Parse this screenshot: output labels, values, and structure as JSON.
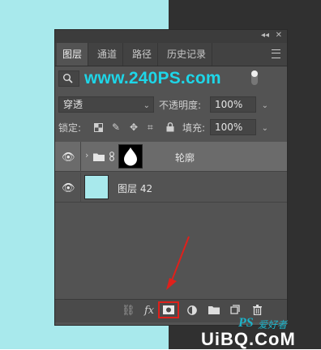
{
  "panel": {
    "titlebar_buttons": {
      "collapse": "◂◂",
      "close": "✕"
    },
    "tabs": [
      {
        "label": "图层",
        "active": true
      },
      {
        "label": "通道",
        "active": false
      },
      {
        "label": "路径",
        "active": false
      },
      {
        "label": "历史记录",
        "active": false
      }
    ],
    "filter": {
      "kind_icon": "search-icon",
      "watermark_text": "www.240PS.com"
    },
    "blend": {
      "mode": "穿透",
      "opacity_label": "不透明度:",
      "opacity_value": "100%"
    },
    "lock": {
      "label": "锁定:",
      "fill_label": "填充:",
      "fill_value": "100%"
    },
    "layers": [
      {
        "name": "轮廓",
        "type": "group",
        "selected": true,
        "mask": "white-drop"
      },
      {
        "name": "图层 42",
        "type": "pixel",
        "selected": false,
        "color": "#a8e9ec"
      }
    ],
    "bottom_icons": [
      "link-icon",
      "fx-icon",
      "add-mask-icon",
      "adjustment-icon",
      "group-folder-icon",
      "new-layer-icon",
      "trash-icon"
    ],
    "bottom_fx_label": "fx"
  },
  "annotation": {
    "highlight_color": "#e0201b"
  },
  "watermark_bottom": {
    "text1": "PS",
    "text2": "爱好者",
    "text3": "UiBQ.CoM"
  }
}
